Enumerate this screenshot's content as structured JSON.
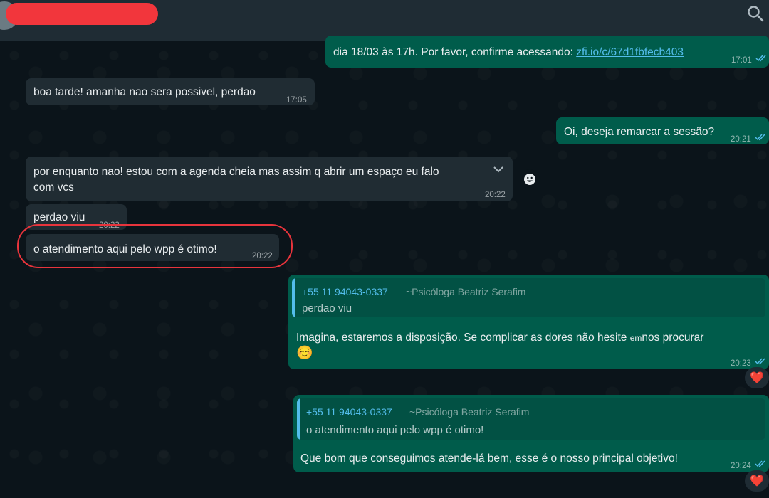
{
  "chat": {
    "messages": [
      {
        "text": "dia 18/03 às 17h. Por favor, confirme acessando: ",
        "link": "zfi.io/c/67d1fbfecb403",
        "time": "17:01"
      },
      {
        "text": "boa tarde! amanha nao sera possivel, perdao",
        "time": "17:05"
      },
      {
        "text": "Oi, deseja remarcar a sessão?",
        "time": "20:21"
      },
      {
        "text_line1": "por enquanto nao! estou com a agenda cheia mas assim q abrir um espaço eu falo",
        "text_line2": "com vcs",
        "time": "20:22"
      },
      {
        "text": "perdao viu",
        "time": "20:22"
      },
      {
        "text": "o atendimento aqui pelo wpp é otimo!",
        "time": "20:22"
      },
      {
        "quote_phone": "+55 11 94043-0337",
        "quote_name": "~Psicóloga Beatriz Serafim",
        "quote_text": "perdao viu",
        "text_line1a": "Imagina, estaremos a disposição. Se complicar as dores não hesite",
        "text_em": "em",
        "text_line1b": "nos procurar",
        "text_line2": "☺️",
        "time": "20:23",
        "reaction": "❤️"
      },
      {
        "quote_phone": "+55 11 94043-0337",
        "quote_name": "~Psicóloga Beatriz Serafim",
        "quote_text": "o atendimento aqui pelo wpp é otimo!",
        "text": "Que bom que conseguimos atende-lá bem, esse é o nosso principal objetivo!",
        "time": "20:24",
        "reaction": "❤️"
      }
    ]
  },
  "colors": {
    "background": "#0b141a",
    "incoming_bubble": "#202c33",
    "outgoing_bubble": "#005c4b",
    "link": "#53bdeb",
    "highlight_circle": "#e8343c",
    "redaction": "#f2363c"
  },
  "icons": {
    "header_right": "search-icon",
    "read_receipt": "double-check-icon",
    "message_menu": "chevron-down-icon",
    "react": "smiley-icon"
  }
}
